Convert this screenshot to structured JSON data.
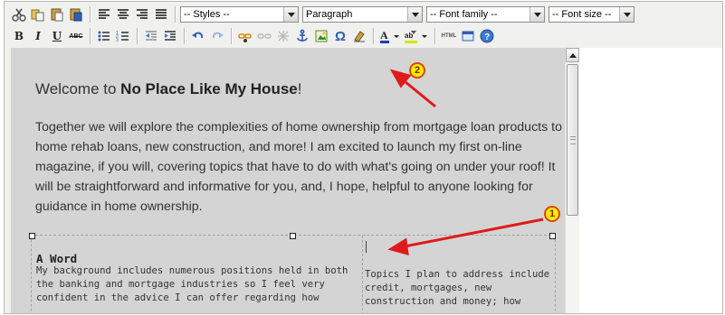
{
  "toolbar": {
    "row1": {
      "buttons": [
        {
          "name": "cut-icon",
          "label": "Cut"
        },
        {
          "name": "copy-icon",
          "label": "Copy"
        },
        {
          "name": "paste-icon",
          "label": "Paste"
        },
        {
          "name": "paste-word-icon",
          "label": "Paste from Word"
        },
        {
          "name": "align-left-icon",
          "label": "Align left"
        },
        {
          "name": "align-center-icon",
          "label": "Align center"
        },
        {
          "name": "align-right-icon",
          "label": "Align right"
        },
        {
          "name": "align-justify-icon",
          "label": "Justify"
        }
      ],
      "styles_select": "-- Styles --",
      "format_select": "Paragraph",
      "font_family_select": "-- Font family --",
      "font_size_select": "-- Font size --"
    },
    "row2": {
      "bold": "B",
      "italic": "I",
      "underline": "U",
      "strike": "ABC",
      "html_label": "HTML"
    }
  },
  "content": {
    "heading_prefix": "Welcome to ",
    "heading_bold": "No Place Like My House",
    "heading_suffix": "!",
    "paragraph": "Together we will explore the complexities of home ownership from mortgage loan products to home rehab loans, new construction, and more! I am excited to launch my first on-line magazine, if you will, covering topics that have to do with what's going on under your roof! It will be straightforward and informative for you, and, I hope, helpful to anyone looking for guidance in home ownership.",
    "table": {
      "left_title": "A Word",
      "left_text": "My background includes numerous positions held in both the banking and mortgage industries so I feel very confident in the advice I can offer regarding how",
      "right_text": "Topics I plan to address include credit, mortgages, new construction and money; how"
    }
  },
  "annotations": [
    {
      "name": "callout-1",
      "label": "1"
    },
    {
      "name": "callout-2",
      "label": "2"
    }
  ],
  "colors": {
    "editor_bg": "#f0f0ee",
    "content_bg": "#d4d4d4",
    "arrow": "#e01a1a",
    "callout_fill": "#ffea00"
  }
}
